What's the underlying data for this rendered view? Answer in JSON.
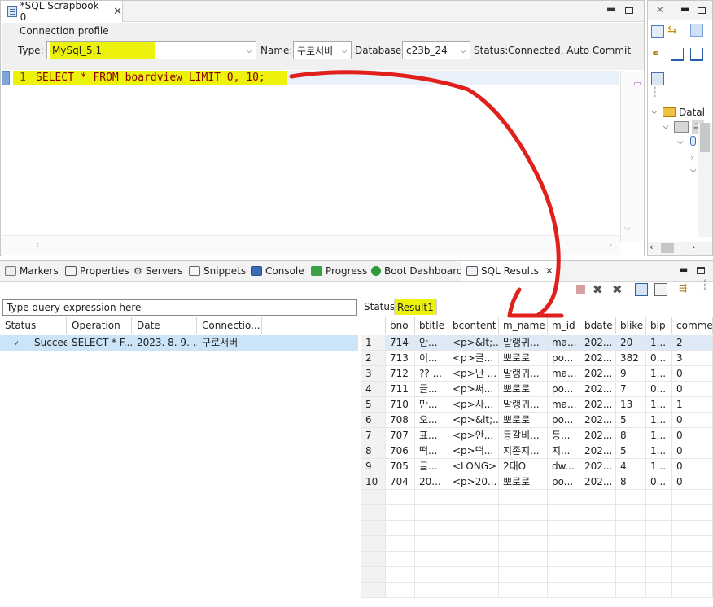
{
  "editor": {
    "tab_title": "*SQL Scrapbook 0",
    "profile_group_label": "Connection profile",
    "type_label": "Type:",
    "type_value": "MySql_5.1",
    "name_label": "Name:",
    "name_value": "구로서버",
    "database_label": "Database:",
    "database_value": "c23b_24",
    "status_label": "Status:",
    "status_value": "Connected, Auto Commit",
    "line_number": "1",
    "sql": "SELECT * FROM boardview LIMIT 0, 10;"
  },
  "outline": {
    "item1": "Datal",
    "item2": "구"
  },
  "bottom_tabs": [
    {
      "label": "Markers"
    },
    {
      "label": "Properties"
    },
    {
      "label": "Servers"
    },
    {
      "label": "Snippets"
    },
    {
      "label": "Console"
    },
    {
      "label": "Progress"
    },
    {
      "label": "Boot Dashboard"
    },
    {
      "label": "SQL Results"
    }
  ],
  "query_filter": {
    "value": "Type query expression here"
  },
  "history": {
    "columns": [
      "Status",
      "Operation",
      "Date",
      "Connectio..."
    ],
    "rows": [
      {
        "status": "Succeed",
        "operation": "SELECT * F...",
        "date": "2023. 8. 9. ...",
        "connection": "구로서버"
      }
    ]
  },
  "result_tabs": {
    "status": "Status",
    "result": "Result1"
  },
  "result": {
    "columns": [
      "bno",
      "btitle",
      "bcontent",
      "m_name",
      "m_id",
      "bdate",
      "blike",
      "bip",
      "commer"
    ],
    "rows": [
      {
        "n": "1",
        "bno": "714",
        "btitle": "안...",
        "bcontent": "<p>&lt;...",
        "m_name": "말랭귀...",
        "m_id": "ma...",
        "bdate": "202...",
        "blike": "20",
        "bip": "1...",
        "comment": "2"
      },
      {
        "n": "2",
        "bno": "713",
        "btitle": "이...",
        "bcontent": "<p>글...",
        "m_name": "뽀로로",
        "m_id": "po...",
        "bdate": "202...",
        "blike": "382",
        "bip": "0...",
        "comment": "3"
      },
      {
        "n": "3",
        "bno": "712",
        "btitle": "?? ...",
        "bcontent": "<p>난 ...",
        "m_name": "말랭귀...",
        "m_id": "ma...",
        "bdate": "202...",
        "blike": "9",
        "bip": "1...",
        "comment": "0"
      },
      {
        "n": "4",
        "bno": "711",
        "btitle": "글...",
        "bcontent": "<p>써...",
        "m_name": "뽀로로",
        "m_id": "po...",
        "bdate": "202...",
        "blike": "7",
        "bip": "0...",
        "comment": "0"
      },
      {
        "n": "5",
        "bno": "710",
        "btitle": "만...",
        "bcontent": "<p>사...",
        "m_name": "말랭귀...",
        "m_id": "ma...",
        "bdate": "202...",
        "blike": "13",
        "bip": "1...",
        "comment": "1"
      },
      {
        "n": "6",
        "bno": "708",
        "btitle": "오...",
        "bcontent": "<p>&lt;...",
        "m_name": "뽀로로",
        "m_id": "po...",
        "bdate": "202...",
        "blike": "5",
        "bip": "1...",
        "comment": "0"
      },
      {
        "n": "7",
        "bno": "707",
        "btitle": "표...",
        "bcontent": "<p>안...",
        "m_name": "등갈비...",
        "m_id": "등...",
        "bdate": "202...",
        "blike": "8",
        "bip": "1...",
        "comment": "0"
      },
      {
        "n": "8",
        "bno": "706",
        "btitle": "떡...",
        "bcontent": "<p>떡...",
        "m_name": "지존지...",
        "m_id": "지...",
        "bdate": "202...",
        "blike": "5",
        "bip": "1...",
        "comment": "0"
      },
      {
        "n": "9",
        "bno": "705",
        "btitle": "글...",
        "bcontent": "<LONG>",
        "m_name": "2대O",
        "m_id": "dw...",
        "bdate": "202...",
        "blike": "4",
        "bip": "1...",
        "comment": "0"
      },
      {
        "n": "10",
        "bno": "704",
        "btitle": "20...",
        "bcontent": "<p>20...",
        "m_name": "뽀로로",
        "m_id": "po...",
        "bdate": "202...",
        "blike": "8",
        "bip": "0...",
        "comment": "0"
      }
    ]
  },
  "colors": {
    "highlight": "#ecf20b",
    "selection": "#cce4f7",
    "annotation": "#e0201b"
  }
}
